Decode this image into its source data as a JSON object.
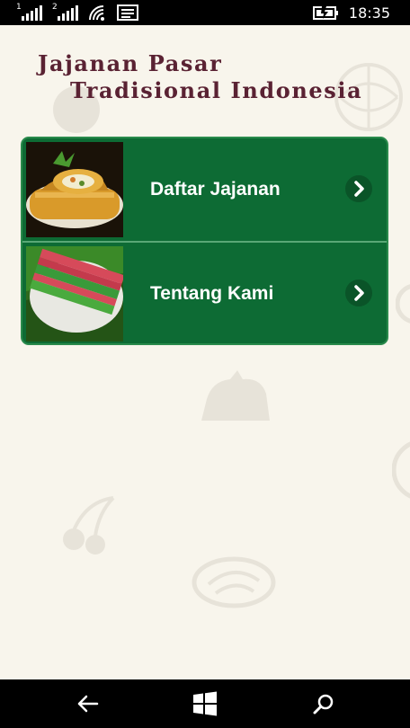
{
  "status_bar": {
    "sim1": "1",
    "sim2": "2",
    "time": "18:35",
    "icons": [
      "signal-icon",
      "signal-icon",
      "wifi-icon",
      "message-icon",
      "battery-charging-icon"
    ]
  },
  "app": {
    "title_line1": "Jajanan Pasar",
    "title_line2": "Tradisional Indonesia",
    "menu": [
      {
        "label": "Daftar Jajanan",
        "thumb": "fried-spring-roll-photo",
        "icon": "chevron-right-icon"
      },
      {
        "label": "Tentang Kami",
        "thumb": "layered-cake-photo",
        "icon": "chevron-right-icon"
      }
    ]
  },
  "nav_bar": {
    "icons": [
      "back-arrow-icon",
      "windows-logo-icon",
      "search-icon"
    ]
  },
  "colors": {
    "background": "#f8f5ec",
    "title": "#5a2233",
    "menu_green": "#0d6b34",
    "divider": "#5aa876"
  }
}
